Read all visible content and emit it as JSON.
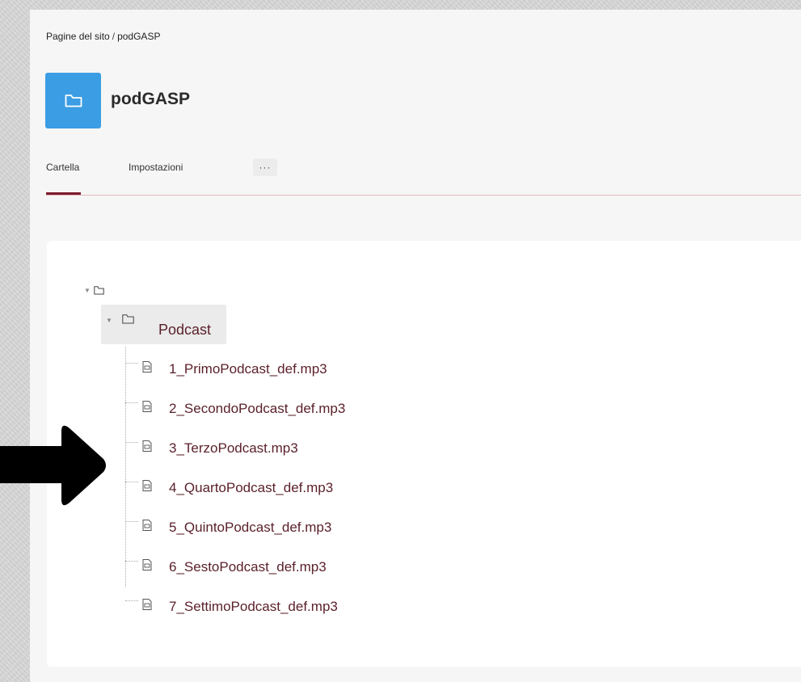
{
  "breadcrumb": {
    "parent": "Pagine del sito",
    "separator": "/",
    "current": "podGASP"
  },
  "header": {
    "title": "podGASP",
    "icon": "folder-icon",
    "badge_color": "#3b9de3"
  },
  "tabs": [
    {
      "label": "Cartella",
      "active": true
    },
    {
      "label": "Impostazioni",
      "active": false
    },
    {
      "label": "···",
      "active": false
    }
  ],
  "accent_color": "#7d1b2e",
  "tree": {
    "root": {
      "icon": "folder-icon",
      "expanded": true
    },
    "folder": {
      "label": "Podcast",
      "icon": "folder-icon",
      "expanded": true
    },
    "files": [
      {
        "label": "1_PrimoPodcast_def.mp3",
        "icon": "audio-file-icon"
      },
      {
        "label": "2_SecondoPodcast_def.mp3",
        "icon": "audio-file-icon"
      },
      {
        "label": "3_TerzoPodcast.mp3",
        "icon": "audio-file-icon"
      },
      {
        "label": "4_QuartoPodcast_def.mp3",
        "icon": "audio-file-icon"
      },
      {
        "label": "5_QuintoPodcast_def.mp3",
        "icon": "audio-file-icon"
      },
      {
        "label": "6_SestoPodcast_def.mp3",
        "icon": "audio-file-icon"
      },
      {
        "label": "7_SettimoPodcast_def.mp3",
        "icon": "audio-file-icon"
      }
    ]
  }
}
